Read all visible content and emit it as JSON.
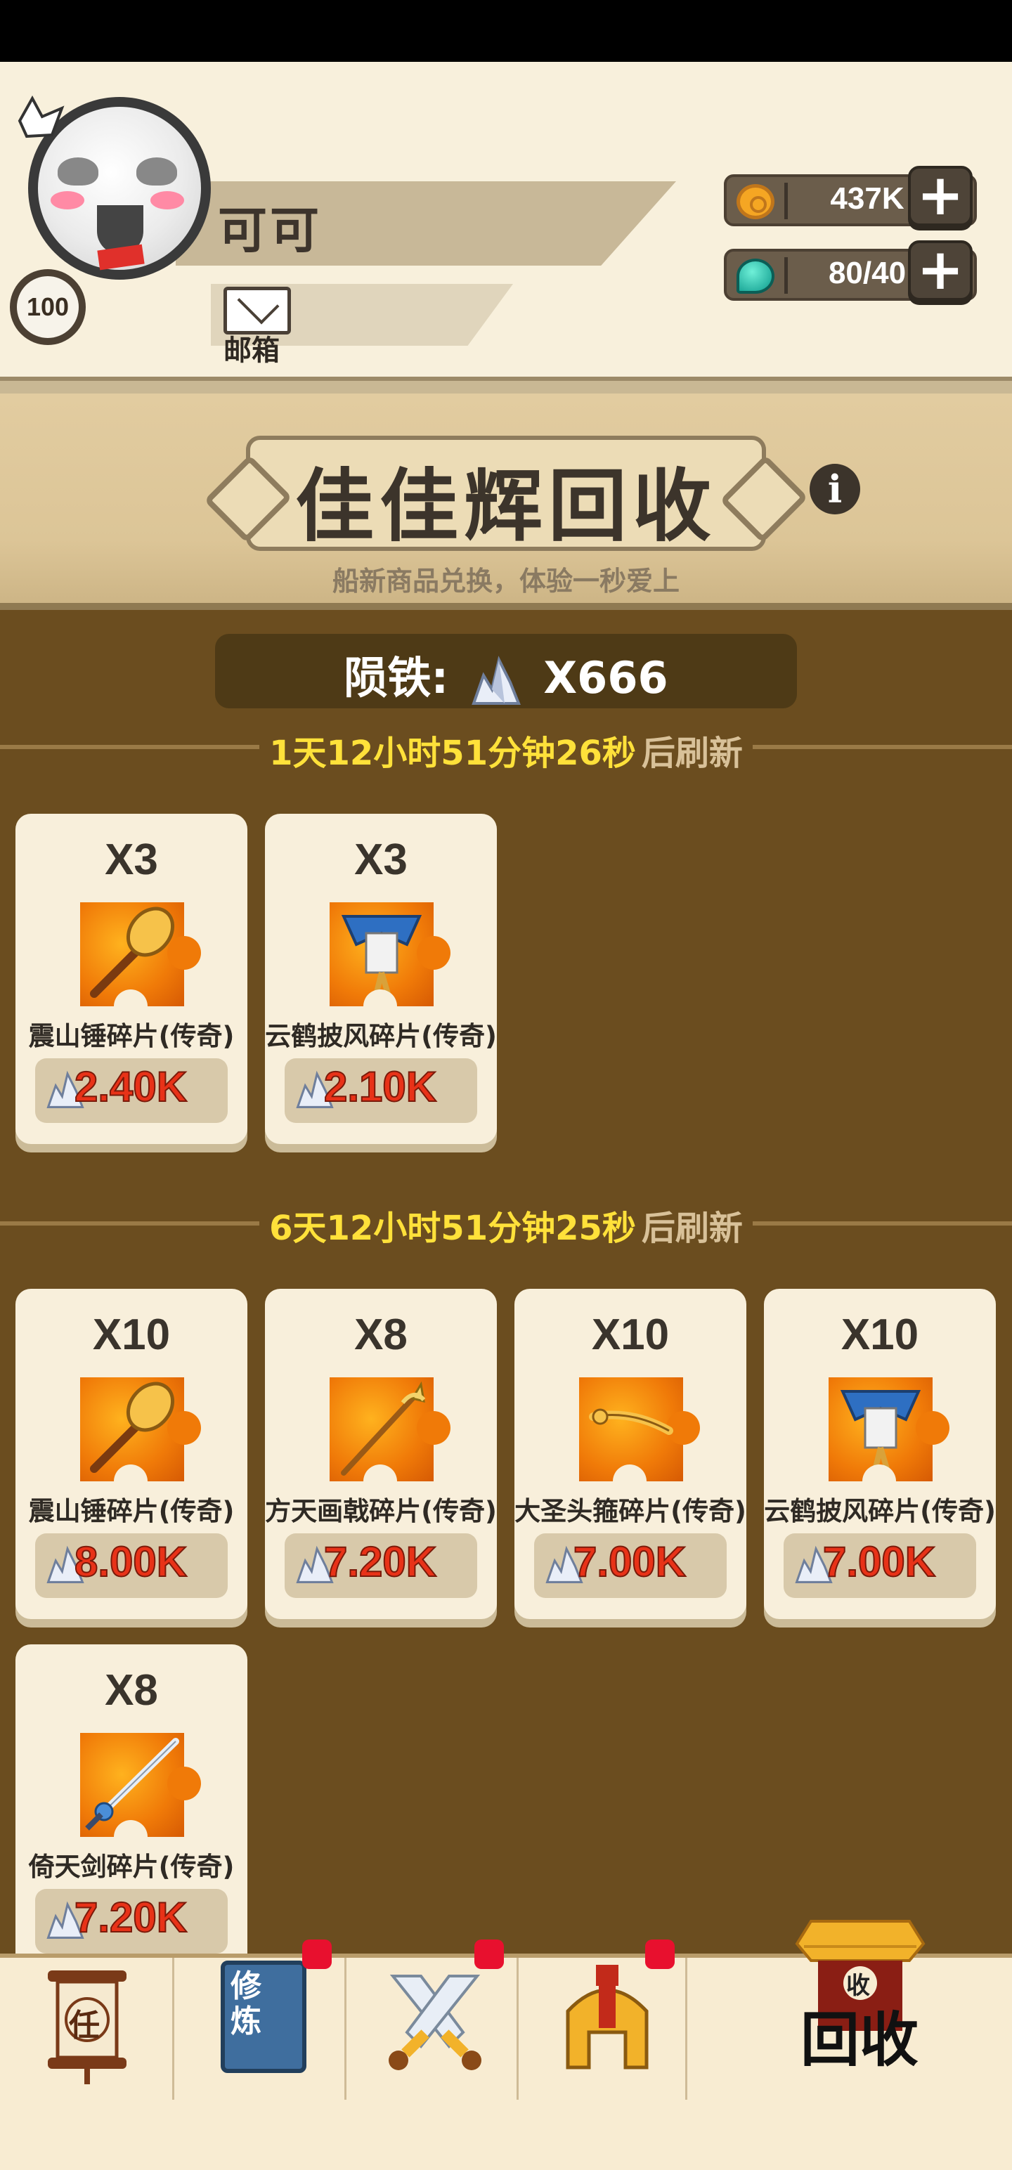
{
  "player": {
    "name": "可可",
    "level": "100",
    "mail_label": "邮箱"
  },
  "resources": {
    "coins": "437K",
    "energy": "80/40"
  },
  "shop": {
    "title": "佳佳辉回收",
    "subtitle": "船新商品兑换，体验一秒爱上",
    "currency_label": "陨铁:",
    "currency_value": "X666"
  },
  "sections": [
    {
      "refresh_time": "1天12小时51分钟26秒",
      "refresh_suffix": "后刷新",
      "items": [
        {
          "qty": "X3",
          "name": "震山锤碎片(传奇)",
          "price": "2.40K",
          "icon": "hammer-icon"
        },
        {
          "qty": "X3",
          "name": "云鹤披风碎片(传奇)",
          "price": "2.10K",
          "icon": "cloak-icon"
        }
      ]
    },
    {
      "refresh_time": "6天12小时51分钟25秒",
      "refresh_suffix": "后刷新",
      "items": [
        {
          "qty": "X10",
          "name": "震山锤碎片(传奇)",
          "price": "8.00K",
          "icon": "hammer-icon"
        },
        {
          "qty": "X8",
          "name": "方天画戟碎片(传奇)",
          "price": "7.20K",
          "icon": "halberd-icon"
        },
        {
          "qty": "X10",
          "name": "大圣头箍碎片(传奇)",
          "price": "7.00K",
          "icon": "headband-icon"
        },
        {
          "qty": "X10",
          "name": "云鹤披风碎片(传奇)",
          "price": "7.00K",
          "icon": "cloak-icon"
        },
        {
          "qty": "X8",
          "name": "倚天剑碎片(传奇)",
          "price": "7.20K",
          "icon": "sword-icon"
        }
      ]
    }
  ],
  "nav": {
    "task_glyph": "任",
    "train_label": "修炼",
    "recycle_roof_glyph": "收",
    "recycle_label": "回收"
  }
}
